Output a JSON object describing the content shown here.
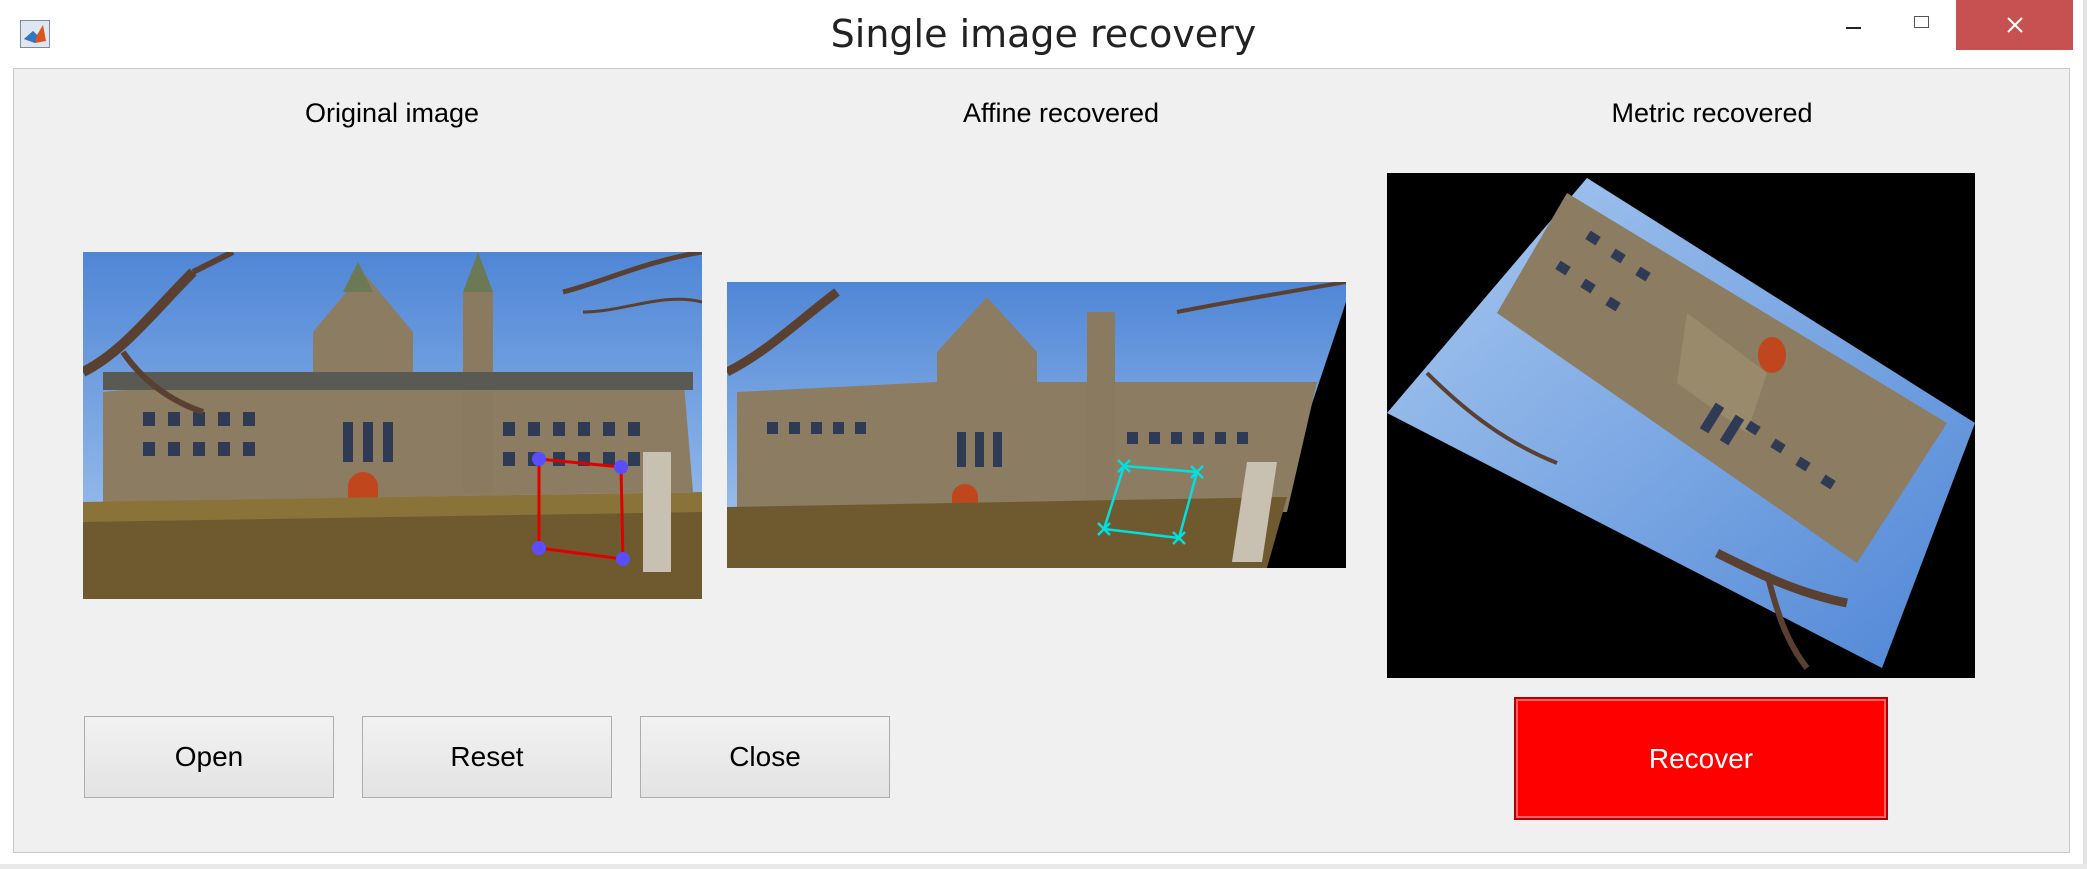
{
  "window": {
    "title": "Single image recovery",
    "app_icon": "matlab-icon",
    "controls": [
      "minimize-icon",
      "maximize-icon",
      "close-icon"
    ]
  },
  "panels": {
    "original": {
      "label": "Original image"
    },
    "affine": {
      "label": "Affine recovered"
    },
    "metric": {
      "label": "Metric recovered"
    }
  },
  "buttons": {
    "open": "Open",
    "reset": "Reset",
    "close": "Close",
    "recover": "Recover"
  },
  "colors": {
    "recover_button": "#ff0000",
    "selection_rectangle": "#e00000",
    "selection_points": "#5a4dff",
    "affine_marker": "#00e0e0",
    "close_button_bg": "#c75050"
  }
}
